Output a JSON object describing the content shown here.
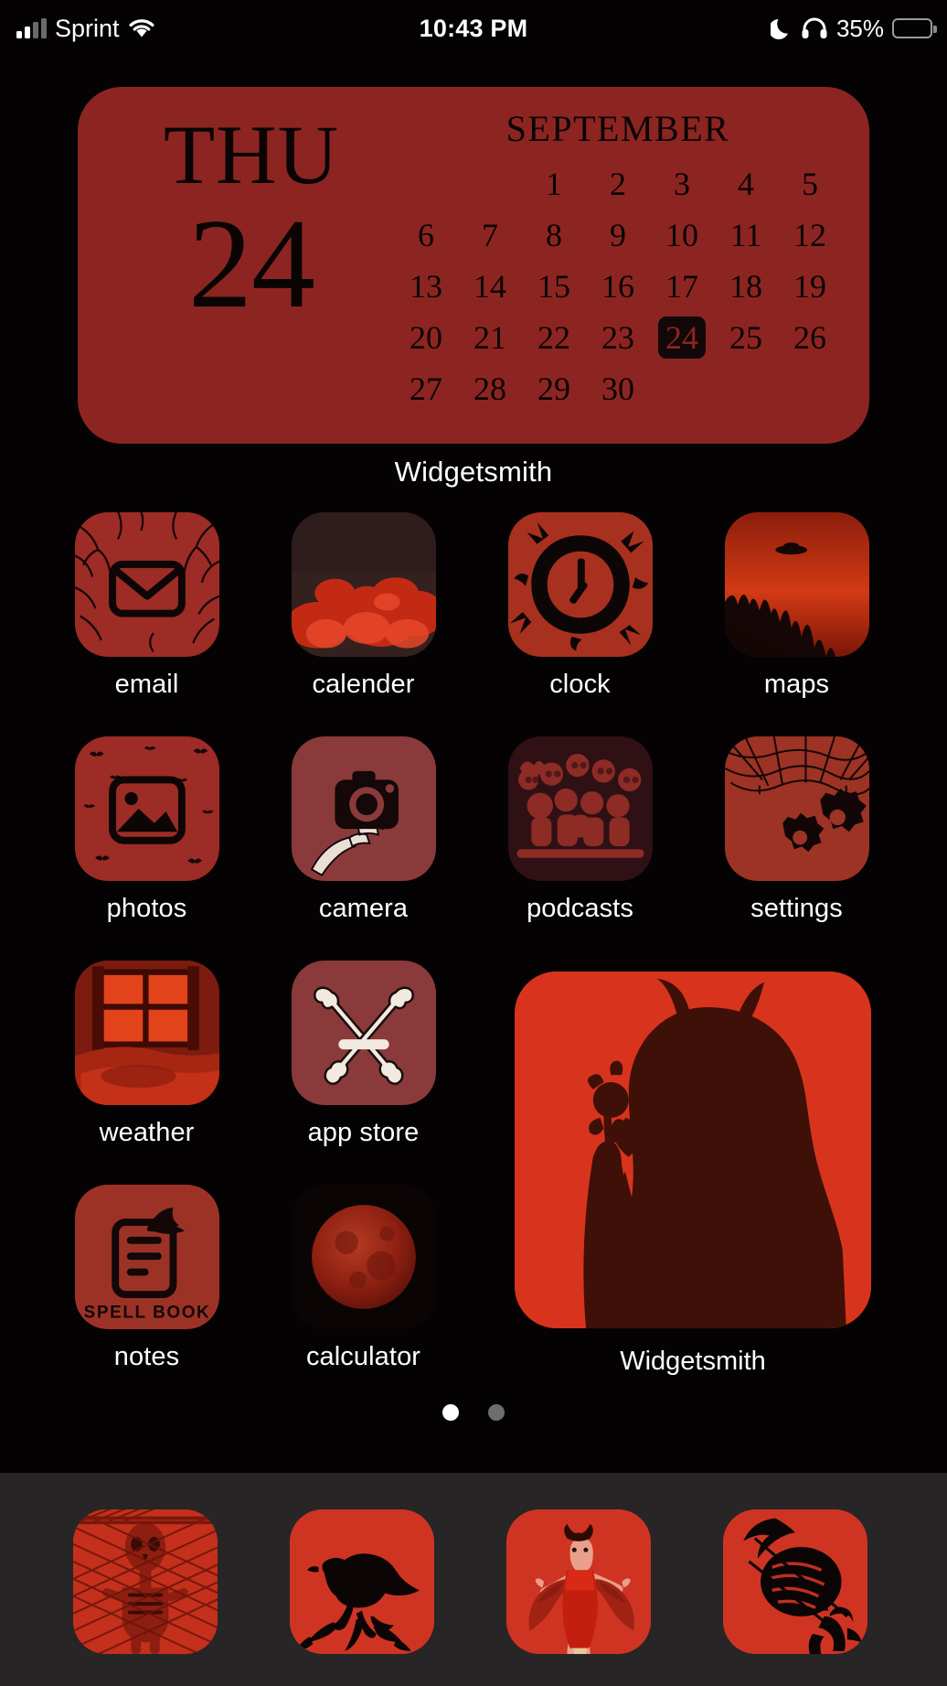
{
  "status_bar": {
    "carrier": "Sprint",
    "time": "10:43 PM",
    "battery_percent": "35%",
    "icons": [
      "signal-bars-icon",
      "wifi-icon",
      "moon-icon",
      "headphones-icon",
      "battery-icon"
    ],
    "battery_fill_color": "#f7d038",
    "battery_level": 35
  },
  "calendar_widget": {
    "weekday": "THU",
    "day": "24",
    "month": "SEPTEMBER",
    "today": 24,
    "lead_blanks": 2,
    "days": [
      1,
      2,
      3,
      4,
      5,
      6,
      7,
      8,
      9,
      10,
      11,
      12,
      13,
      14,
      15,
      16,
      17,
      18,
      19,
      20,
      21,
      22,
      23,
      24,
      25,
      26,
      27,
      28,
      29,
      30
    ],
    "label": "Widgetsmith",
    "background_color": "#8c2521",
    "text_color": "#0b0405"
  },
  "apps": [
    [
      {
        "label": "email",
        "icon": "mail-envelope-icon"
      },
      {
        "label": "calender",
        "icon": "red-clouds-icon"
      },
      {
        "label": "clock",
        "icon": "clock-splatter-icon"
      },
      {
        "label": "maps",
        "icon": "ufo-forest-icon"
      }
    ],
    [
      {
        "label": "photos",
        "icon": "photo-bats-icon"
      },
      {
        "label": "camera",
        "icon": "skeleton-hand-camera-icon"
      },
      {
        "label": "podcasts",
        "icon": "skeletons-table-icon"
      },
      {
        "label": "settings",
        "icon": "gears-cobweb-icon"
      }
    ],
    [
      {
        "label": "weather",
        "icon": "red-room-window-icon"
      },
      {
        "label": "app store",
        "icon": "crossed-bones-a-icon"
      }
    ],
    [
      {
        "label": "notes",
        "icon": "spell-book-icon",
        "caption": "SPELL BOOK"
      },
      {
        "label": "calculator",
        "icon": "blood-moon-icon"
      }
    ]
  ],
  "photo_widget": {
    "label": "Widgetsmith",
    "icon": "devil-silhouette-flower-photo",
    "background_color": "#d8341d"
  },
  "page_dots": {
    "count": 2,
    "active_index": 0
  },
  "dock": [
    {
      "icon": "skeleton-fence-icon",
      "name": "dock-app-1"
    },
    {
      "icon": "raven-branch-icon",
      "name": "dock-app-2"
    },
    {
      "icon": "devil-woman-icon",
      "name": "dock-app-3"
    },
    {
      "icon": "moon-cat-icon",
      "name": "dock-app-4"
    }
  ],
  "colors": {
    "widget_red": "#8c2521",
    "icon_red": "#9c2c25",
    "bright_red": "#d8341d",
    "background": "#050203"
  }
}
